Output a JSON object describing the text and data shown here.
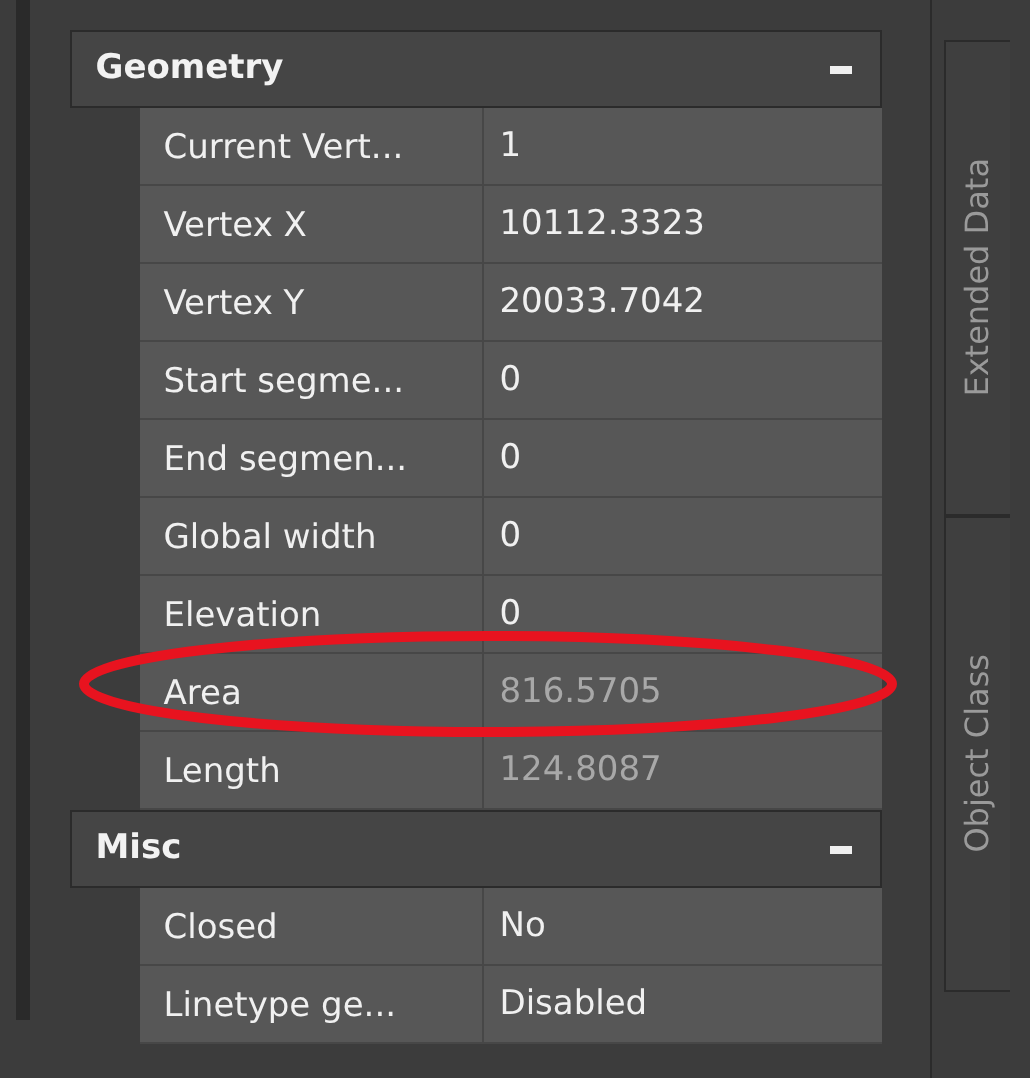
{
  "sections": [
    {
      "title": "Geometry",
      "expanded": true,
      "rows": [
        {
          "label": "Current Vert...",
          "value": "1",
          "disabled": false
        },
        {
          "label": "Vertex X",
          "value": "10112.3323",
          "disabled": false
        },
        {
          "label": "Vertex Y",
          "value": "20033.7042",
          "disabled": false
        },
        {
          "label": "Start segme...",
          "value": "0",
          "disabled": false
        },
        {
          "label": "End segmen...",
          "value": "0",
          "disabled": false
        },
        {
          "label": "Global width",
          "value": "0",
          "disabled": false
        },
        {
          "label": "Elevation",
          "value": "0",
          "disabled": false
        },
        {
          "label": "Area",
          "value": "816.5705",
          "disabled": true
        },
        {
          "label": "Length",
          "value": "124.8087",
          "disabled": true
        }
      ]
    },
    {
      "title": "Misc",
      "expanded": true,
      "rows": [
        {
          "label": "Closed",
          "value": "No",
          "disabled": false
        },
        {
          "label": "Linetype ge...",
          "value": "Disabled",
          "disabled": false
        }
      ]
    }
  ],
  "side_tabs": [
    {
      "label": "Extended Data",
      "selected": false
    },
    {
      "label": "Object Class",
      "selected": false
    }
  ]
}
